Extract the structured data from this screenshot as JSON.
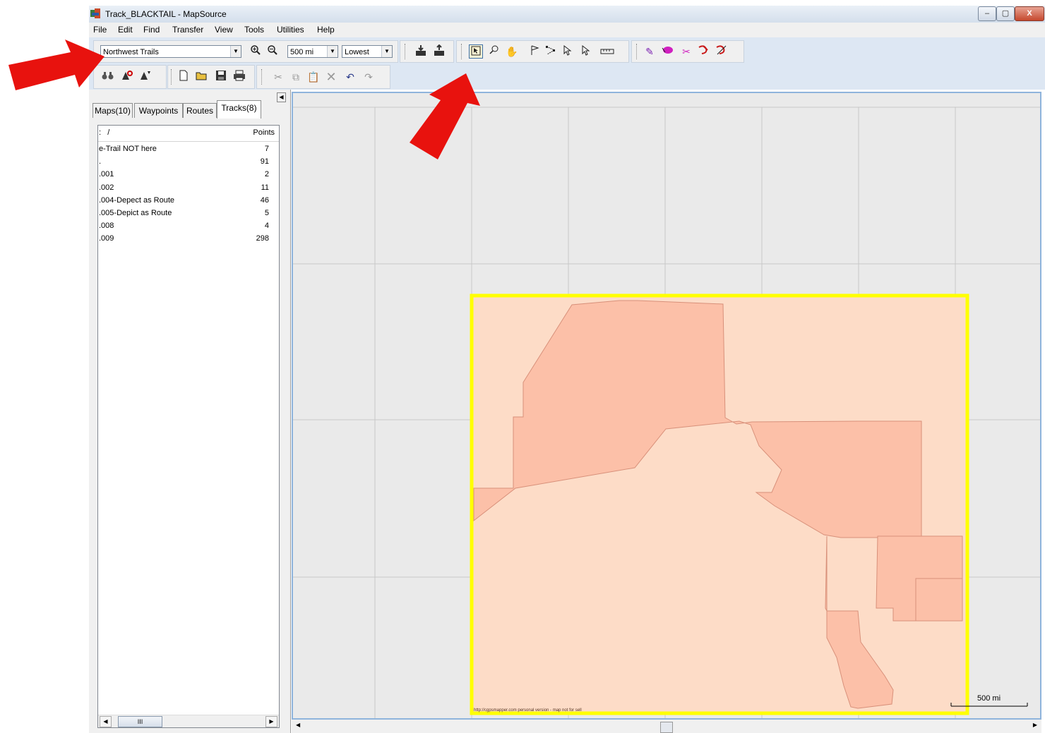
{
  "window": {
    "title": "Track_BLACKTAIL - MapSource",
    "controls": [
      "–",
      "▢",
      "X"
    ]
  },
  "menu": [
    "File",
    "Edit",
    "Find",
    "Transfer",
    "View",
    "Tools",
    "Utilities",
    "Help"
  ],
  "toolbar": {
    "map_product": "Northwest Trails",
    "zoom_scale": "500 mi",
    "detail_level": "Lowest"
  },
  "panel": {
    "tabs": [
      "Maps(10)",
      "Waypoints",
      "Routes",
      "Tracks(8)"
    ],
    "active_tab": "Tracks(8)",
    "list_header": {
      "name": "/",
      "points": "Points"
    },
    "tracks": [
      {
        "name": "e-Trail NOT here",
        "points": "7"
      },
      {
        "name": ".",
        "points": "91"
      },
      {
        "name": ".001",
        "points": "2"
      },
      {
        "name": ".002",
        "points": "11"
      },
      {
        "name": ".004-Depect as Route",
        "points": "46"
      },
      {
        "name": ".005-Depict as Route",
        "points": "5"
      },
      {
        "name": ".008",
        "points": "4"
      },
      {
        "name": ".009",
        "points": "298"
      }
    ],
    "scroll_thumb": "III"
  },
  "map": {
    "scale_label": "500 mi",
    "credit": "http://cgpsmapper.com personal version - map not for sell",
    "colors": {
      "background": "#eaeaea",
      "map_fill": "#fddcc7",
      "region_fill": "#fcc0a8",
      "region_stroke": "#d8907a",
      "highlight_border": "#ffff00",
      "grid": "#c8c8c8"
    }
  },
  "annotations": {
    "arrow_color": "#e8120e"
  }
}
